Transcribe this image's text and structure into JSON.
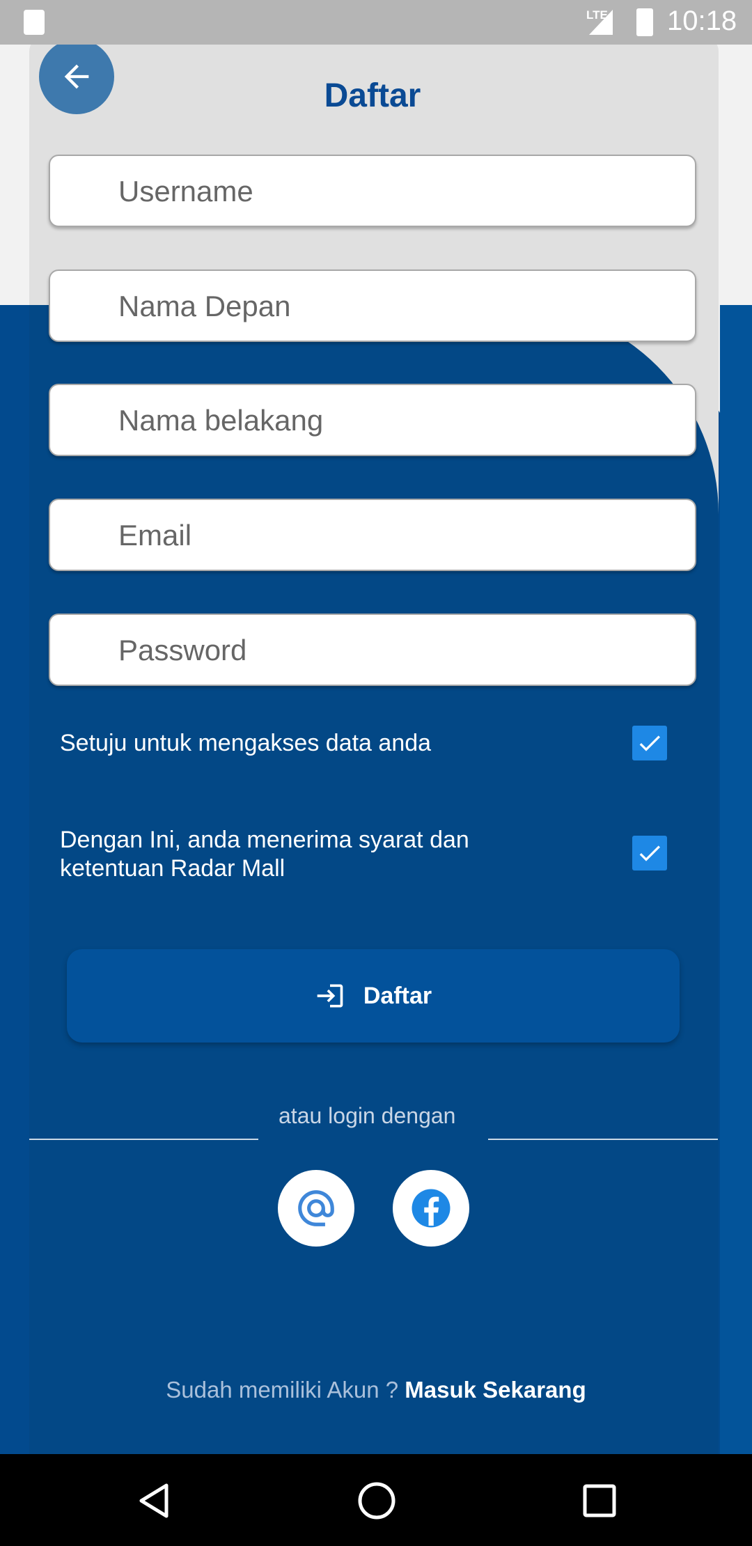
{
  "status_bar": {
    "time": "10:18",
    "network": "LTE"
  },
  "header": {
    "title": "Daftar"
  },
  "form": {
    "username_placeholder": "Username",
    "first_name_placeholder": "Nama Depan",
    "last_name_placeholder": "Nama belakang",
    "email_placeholder": "Email",
    "password_placeholder": "Password"
  },
  "checks": [
    {
      "label": "Setuju untuk mengakses data anda",
      "checked": true
    },
    {
      "label": "Dengan Ini, anda menerima syarat dan ketentuan Radar Mall",
      "checked": true
    }
  ],
  "submit": {
    "label": "Daftar"
  },
  "divider": {
    "text": "atau login dengan"
  },
  "social": [
    "email-icon",
    "facebook-icon"
  ],
  "footer": {
    "prompt": "Sudah memiliki Akun ?",
    "link": "Masuk Sekarang"
  },
  "colors": {
    "primary": "#034886",
    "accent": "#1e88e5",
    "title": "#0a4a94"
  }
}
